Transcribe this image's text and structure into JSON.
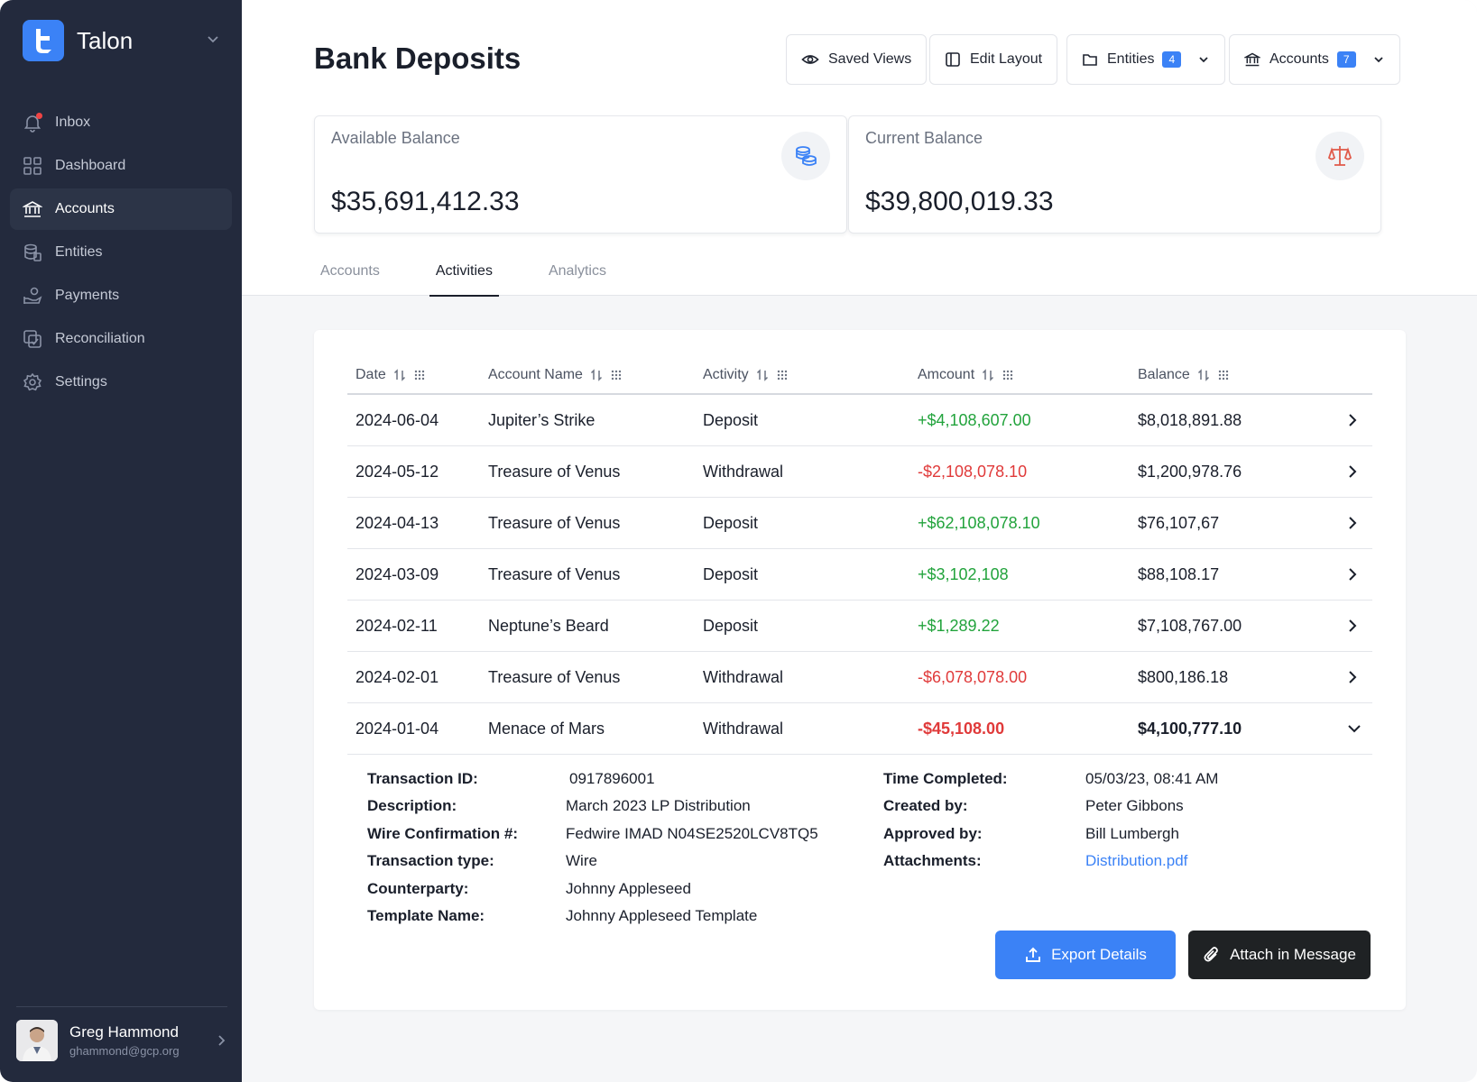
{
  "app": {
    "name": "Talon"
  },
  "nav": [
    {
      "label": "Inbox",
      "icon": "bell-icon"
    },
    {
      "label": "Dashboard",
      "icon": "grid-icon"
    },
    {
      "label": "Accounts",
      "icon": "bank-icon",
      "active": true
    },
    {
      "label": "Entities",
      "icon": "database-icon"
    },
    {
      "label": "Payments",
      "icon": "hand-coins-icon"
    },
    {
      "label": "Reconciliation",
      "icon": "reconcile-icon"
    },
    {
      "label": "Settings",
      "icon": "gear-icon"
    }
  ],
  "user": {
    "name": "Greg Hammond",
    "email": "ghammond@gcp.org"
  },
  "page": {
    "title": "Bank Deposits"
  },
  "toolbar": {
    "saved_views": "Saved Views",
    "edit_layout": "Edit Layout",
    "entities": "Entities",
    "entities_count": "4",
    "accounts": "Accounts",
    "accounts_count": "7"
  },
  "cards": {
    "available": {
      "label": "Available Balance",
      "value": "$35,691,412.33"
    },
    "current": {
      "label": "Current Balance",
      "value": "$39,800,019.33"
    }
  },
  "tabs": [
    {
      "label": "Accounts"
    },
    {
      "label": "Activities",
      "active": true
    },
    {
      "label": "Analytics"
    }
  ],
  "table": {
    "headers": {
      "date": "Date",
      "name": "Account Name",
      "activity": "Activity",
      "amount": "Amcount",
      "balance": "Balance"
    },
    "rows": [
      {
        "date": "2024-06-04",
        "name": "Jupiter’s Strike",
        "activity": "Deposit",
        "amount": "+$4,108,607.00",
        "balance": "$8,018,891.88"
      },
      {
        "date": "2024-05-12",
        "name": "Treasure of Venus",
        "activity": "Withdrawal",
        "amount": "-$2,108,078.10",
        "balance": "$1,200,978.76"
      },
      {
        "date": "2024-04-13",
        "name": "Treasure of Venus",
        "activity": "Deposit",
        "amount": "+$62,108,078.10",
        "balance": "$76,107,67"
      },
      {
        "date": "2024-03-09",
        "name": "Treasure of Venus",
        "activity": "Deposit",
        "amount": "+$3,102,108",
        "balance": "$88,108.17"
      },
      {
        "date": "2024-02-11",
        "name": "Neptune’s Beard",
        "activity": "Deposit",
        "amount": "+$1,289.22",
        "balance": "$7,108,767.00"
      },
      {
        "date": "2024-02-01",
        "name": "Treasure of Venus",
        "activity": "Withdrawal",
        "amount": "-$6,078,078.00",
        "balance": "$800,186.18"
      },
      {
        "date": "2024-01-04",
        "name": "Menace of Mars",
        "activity": "Withdrawal",
        "amount": "-$45,108.00",
        "balance": "$4,100,777.10",
        "expanded": true
      }
    ]
  },
  "details": {
    "transaction_id_label": "Transaction ID:",
    "transaction_id": "0917896001",
    "description_label": "Description:",
    "description": "March 2023 LP Distribution",
    "wire_label": "Wire Confirmation #:",
    "wire": "Fedwire IMAD N04SE2520LCV8TQ5",
    "type_label": "Transaction type:",
    "type": "Wire",
    "counterparty_label": "Counterparty:",
    "counterparty": "Johnny Appleseed",
    "template_label": "Template Name:",
    "template": "Johnny Appleseed Template",
    "time_label": "Time Completed:",
    "time": "05/03/23, 08:41 AM",
    "created_label": "Created by:",
    "created": "Peter Gibbons",
    "approved_label": "Approved by:",
    "approved": "Bill Lumbergh",
    "attachments_label": "Attachments:",
    "attachment": "Distribution.pdf"
  },
  "actions": {
    "export": "Export Details",
    "attach": "Attach in Message"
  },
  "colors": {
    "accent": "#3b82f6",
    "sidebar": "#232a3d",
    "positive": "#22a33c",
    "negative": "#e03a3a"
  }
}
